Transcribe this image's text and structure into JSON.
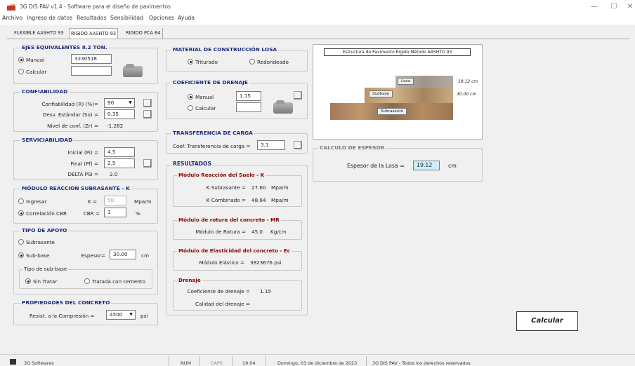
{
  "window": {
    "title": "3G DIS PAV v1.4 - Software para el diseño de pavimentos",
    "minimize": "—",
    "maximize": "☐",
    "close": "✕"
  },
  "menu": [
    "Archivo",
    "Ingreso de datos",
    "Resultados",
    "Sensibilidad",
    "Opciones",
    "Ayuda"
  ],
  "tabs": [
    "FLEXIBLE AASHTO 93",
    "RIGIDO AASHTO 93",
    "RIGIDO PCA 84"
  ],
  "ejes": {
    "title": "EJES EQUIVALENTES 8.2 TON.",
    "manual_label": "Manual",
    "manual_value": "3230518",
    "calcular_label": "Calcular",
    "calcular_value": ""
  },
  "confiabilidad": {
    "title": "CONFIABILIDAD",
    "r_label": "Confiabilidad (R) (%)=",
    "r_value": "90",
    "so_label": "Desv. Estándar (So) =",
    "so_value": "0.35",
    "zr_label": "Nivel de conf. (Zr) =",
    "zr_value": "-1.282"
  },
  "serviciabilidad": {
    "title": "SERVICIABILIDAD",
    "pi_label": "Inicial (Pi) =",
    "pi_value": "4.5",
    "pf_label": "Final (Pf) =",
    "pf_value": "2.5",
    "dpsi_label": "DELTA PSI =",
    "dpsi_value": "2.0"
  },
  "modulo": {
    "title": "MÓDULO REACCION SUBRASANTE - K",
    "ingresar_label": "Ingresar",
    "k_label": "K =",
    "k_value": "50",
    "k_unit": "Mpa/m",
    "cbr_radio_label": "Correlación CBR",
    "cbr_label": "CBR =",
    "cbr_value": "3",
    "cbr_unit": "%"
  },
  "apoyo": {
    "title": "TIPO DE APOYO",
    "subrasante_label": "Subrasante",
    "subbase_label": "Sub-base",
    "espesor_label": "Espesor=",
    "espesor_value": "30.00",
    "espesor_unit": "cm",
    "tipo_title": "Tipo de sub-base",
    "sin_tratar_label": "Sin Tratar",
    "tratada_label": "Tratada con cemento"
  },
  "concreto": {
    "title": "PROPIEDADES DEL CONCRETO",
    "label": "Resist. a la Compresión =",
    "value": "4500",
    "unit": "psi"
  },
  "material": {
    "title": "MATERIAL DE CONSTRUCCIÓN LOSA",
    "triturado_label": "Triturado",
    "redondeado_label": "Redondeado"
  },
  "drenaje": {
    "title": "COEFICIENTE DE DRENAJE",
    "manual_label": "Manual",
    "manual_value": "1.15",
    "calcular_label": "Calcular",
    "calcular_value": ""
  },
  "transferencia": {
    "title": "TRANSFERENCIA DE CARGA",
    "label": "Coef. Transferencia de carga =",
    "value": "3.1"
  },
  "resultados": {
    "title": "RESULTADOS",
    "suelo_title": "Módulo Reacción del Suelo - K",
    "ksub_label": "K Subrasante =",
    "ksub_value": "27.60",
    "ksub_unit": "Mpa/m",
    "kcomb_label": "K Combinado =",
    "kcomb_value": "48.64",
    "kcomb_unit": "Mpa/m",
    "mr_title": "Módulo de rotura del concreto - MR",
    "mr_label": "Módulo de Rotura =",
    "mr_value": "45.0",
    "mr_unit": "Kg/cm",
    "ec_title": "Módulo de Elasticidad del concreto - Ec",
    "ec_label": "Módulo Elástico =",
    "ec_value": "3823676 psi",
    "dren_title": "Drenaje",
    "coef_label": "Coeficiente de drenaje =",
    "coef_value": "1.15",
    "calidad_label": "Calidad del drenaje =",
    "calidad_value": ""
  },
  "estructura": {
    "caption": "Estructura de Pavimento Rígido Método AASHTO 93",
    "losa_label": "Losa",
    "losa_thickness": "19.12 cm",
    "subbase_label": "Subbase",
    "subbase_thickness": "30.00 cm",
    "subrasante_label": "Subrasante"
  },
  "calculo": {
    "title": "CALCULO DE ESPESOR",
    "label": "Espesor de la Losa =",
    "value": "19.12",
    "unit": "cm"
  },
  "calcular_button": "Calcular",
  "status": {
    "company": "3G Softwares",
    "num": "NUM",
    "caps": "CAPS",
    "time": "19:04",
    "date": "Domingo, 03 de diciembre de 2023",
    "rights": "3G DIS PAV - Todos los derechos reservados"
  },
  "colors": {
    "group_title": "#1b2b80",
    "result_title": "#8b0000",
    "highlight_input": "#cceeff"
  }
}
